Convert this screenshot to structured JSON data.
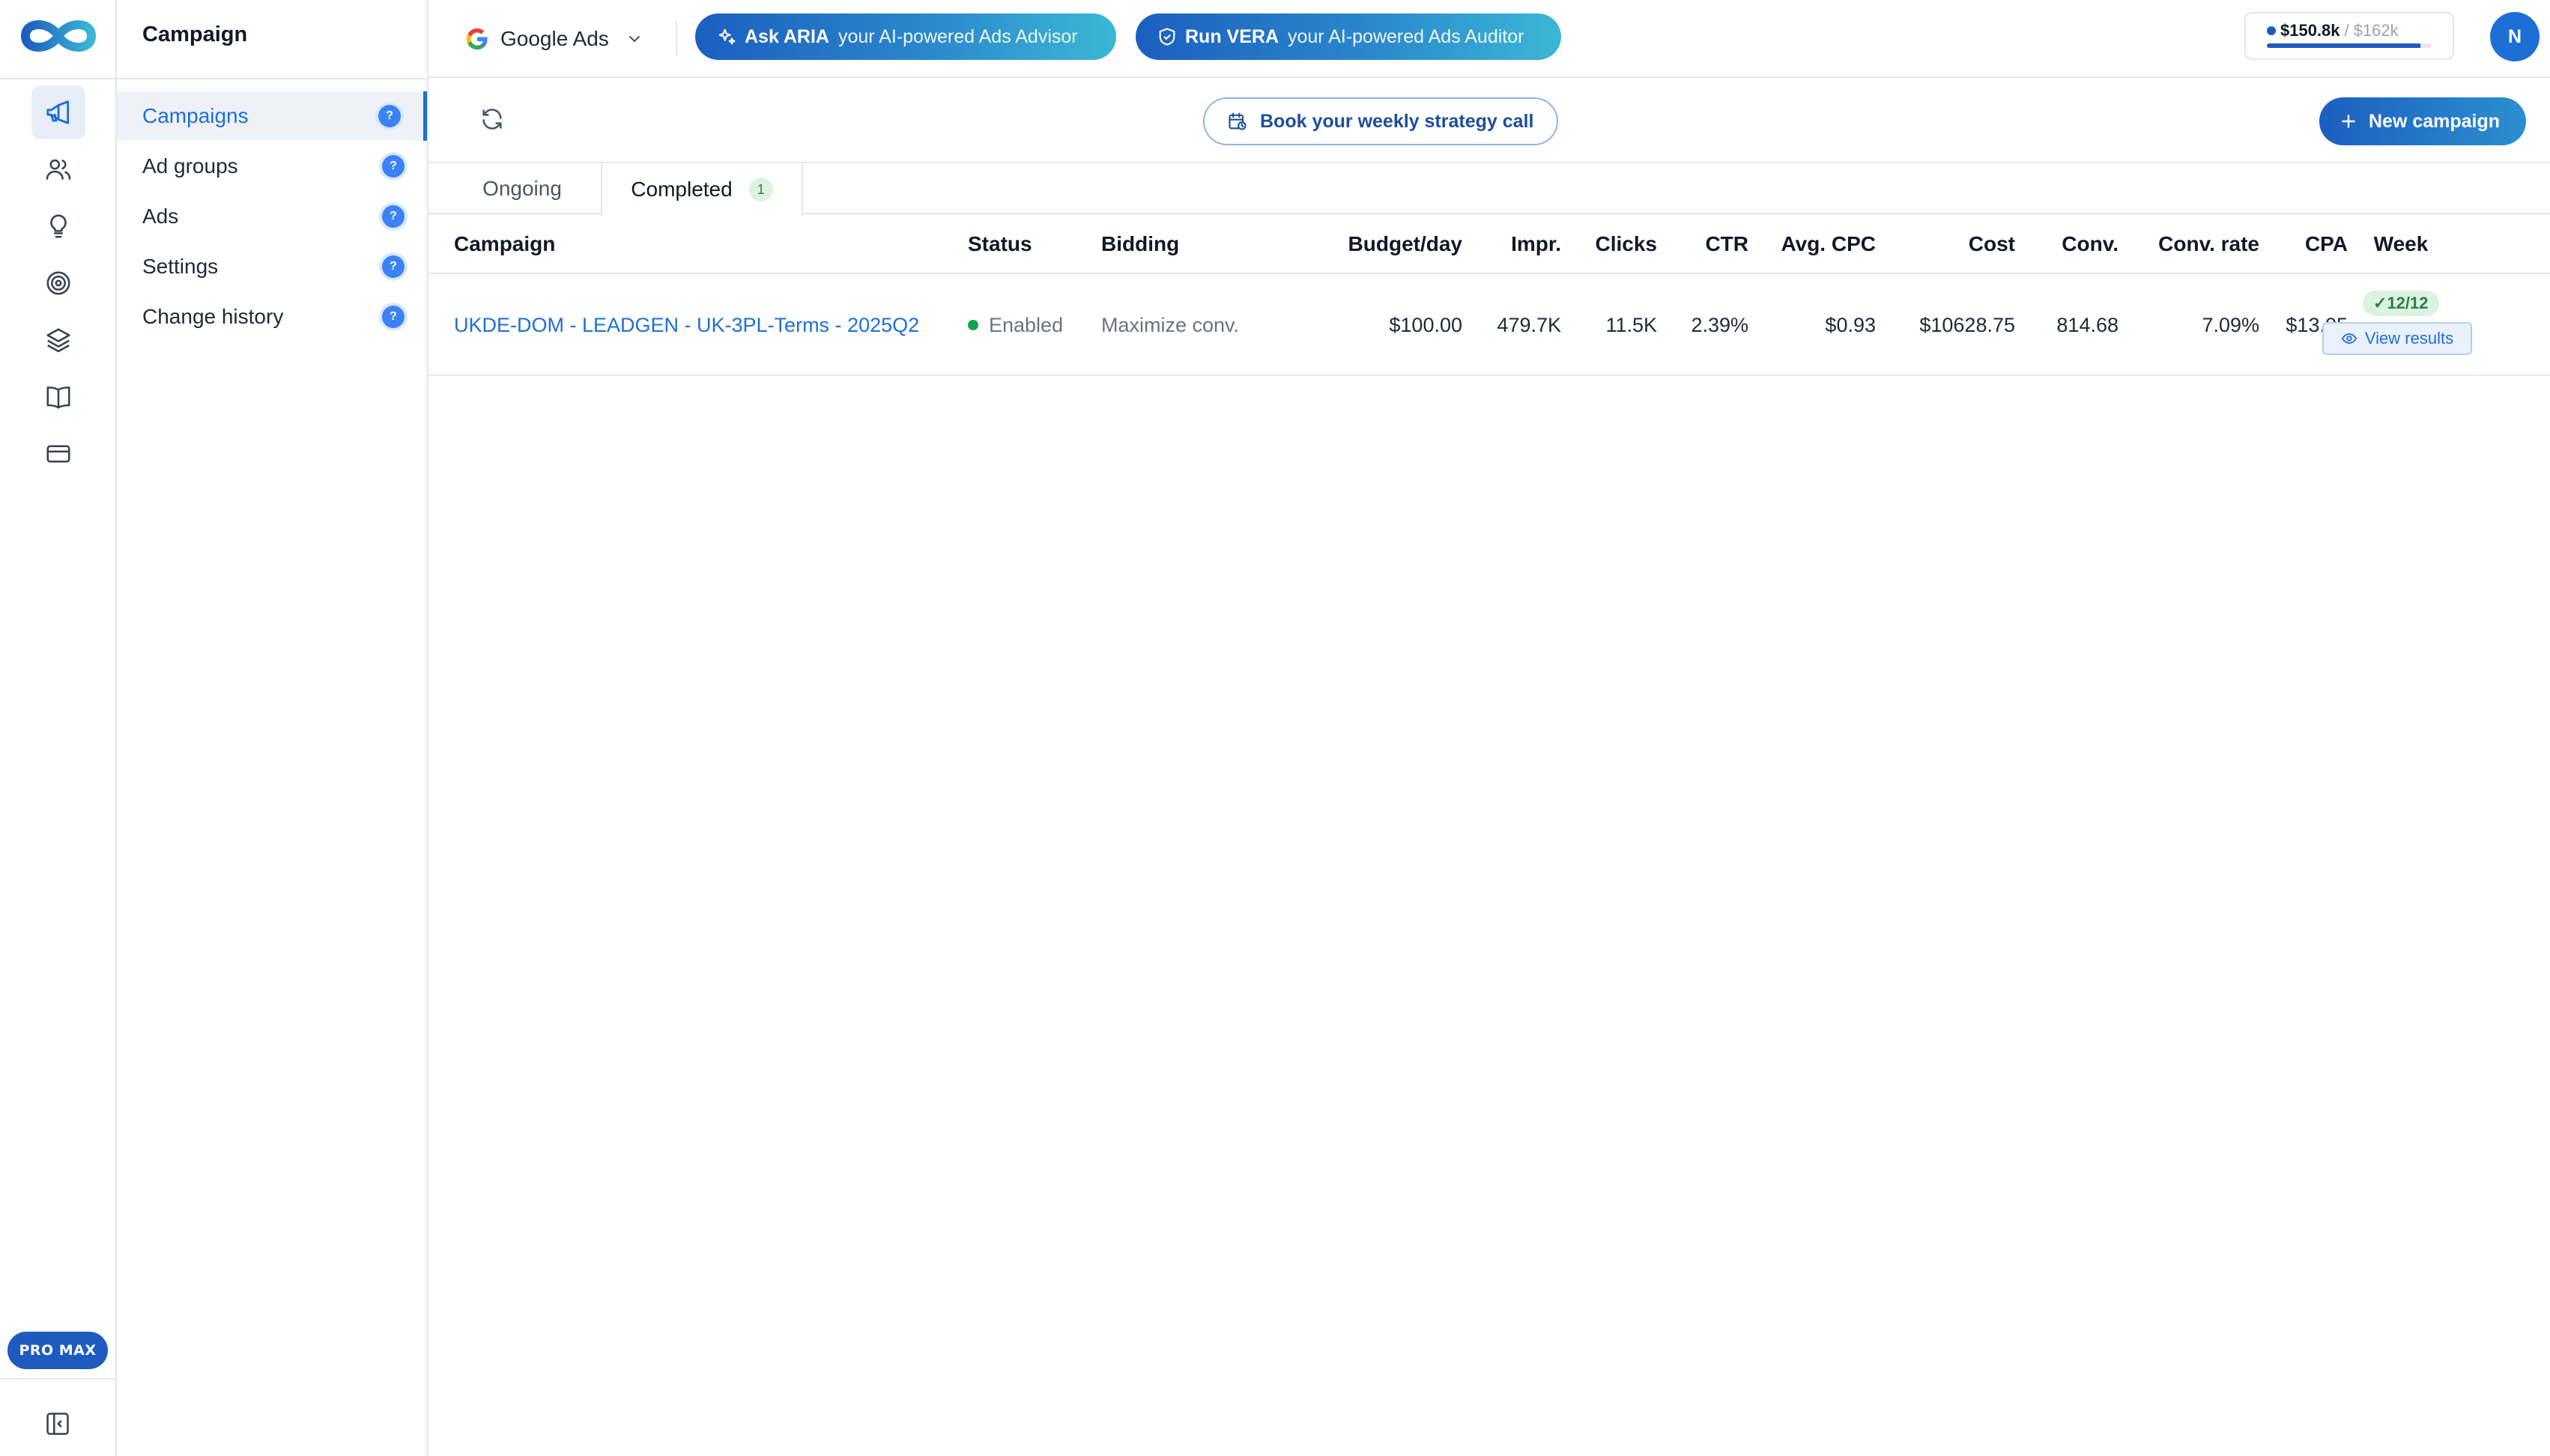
{
  "rail": {
    "items": [
      {
        "icon": "megaphone-icon",
        "active": true
      },
      {
        "icon": "users-icon",
        "active": false
      },
      {
        "icon": "lightbulb-icon",
        "active": false
      },
      {
        "icon": "target-icon",
        "active": false
      },
      {
        "icon": "layers-icon",
        "active": false
      },
      {
        "icon": "book-icon",
        "active": false
      },
      {
        "icon": "credit-card-icon",
        "active": false
      }
    ],
    "plan_badge": "PRO MAX"
  },
  "subnav": {
    "title": "Campaign",
    "items": [
      {
        "label": "Campaigns",
        "active": true
      },
      {
        "label": "Ad groups",
        "active": false
      },
      {
        "label": "Ads",
        "active": false
      },
      {
        "label": "Settings",
        "active": false
      },
      {
        "label": "Change history",
        "active": false
      }
    ],
    "help_glyph": "?"
  },
  "topbar": {
    "platform": "Google Ads",
    "aria": {
      "strong": "Ask ARIA",
      "sub": "your AI-powered Ads Advisor"
    },
    "vera": {
      "strong": "Run VERA",
      "sub": "your AI-powered Ads Auditor"
    },
    "budget": {
      "spent": "$150.8k",
      "separator": "/",
      "limit": "$162k",
      "progress_fraction": 0.93
    },
    "avatar_initial": "N"
  },
  "toolbar": {
    "book_call_label": "Book your weekly strategy call",
    "new_campaign_label": "New campaign"
  },
  "tabs": [
    {
      "label": "Ongoing",
      "count": null,
      "active": false
    },
    {
      "label": "Completed",
      "count": "1",
      "active": true
    }
  ],
  "table": {
    "columns": [
      "Campaign",
      "Status",
      "Bidding",
      "Budget/day",
      "Impr.",
      "Clicks",
      "CTR",
      "Avg. CPC",
      "Cost",
      "Conv.",
      "Conv. rate",
      "CPA",
      "Week"
    ],
    "rows": [
      {
        "campaign": "UKDE-DOM - LEADGEN - UK-3PL-Terms - 2025Q2",
        "status": "Enabled",
        "bidding": "Maximize conv.",
        "budget_day": "$100.00",
        "impr": "479.7K",
        "clicks": "11.5K",
        "ctr": "2.39%",
        "avg_cpc": "$0.93",
        "cost": "$10628.75",
        "conv": "814.68",
        "conv_rate": "7.09%",
        "cpa": "$13.05",
        "week": "12/12",
        "week_check": "✓",
        "view_results_label": "View results"
      }
    ]
  },
  "colors": {
    "accent": "#1d6fd6",
    "brand_dark": "#1d5bbf",
    "success": "#16a34a"
  }
}
